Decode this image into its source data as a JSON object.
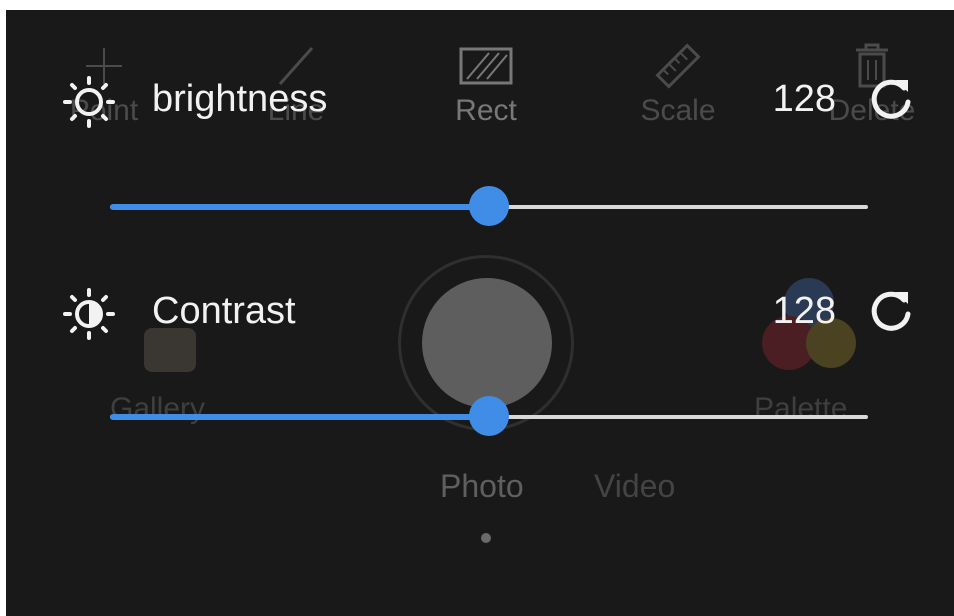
{
  "background_ui": {
    "tools": [
      {
        "id": "point",
        "label": "Point",
        "icon": "crosshair-icon"
      },
      {
        "id": "line",
        "label": "Line",
        "icon": "line-icon"
      },
      {
        "id": "rect",
        "label": "Rect",
        "icon": "rect-icon"
      },
      {
        "id": "scale",
        "label": "Scale",
        "icon": "ruler-icon"
      },
      {
        "id": "delete",
        "label": "Delete",
        "icon": "trash-icon"
      }
    ],
    "gallery_label": "Gallery",
    "palette_label": "Palette",
    "modes": {
      "photo": "Photo",
      "video": "Video"
    }
  },
  "controls": [
    {
      "id": "brightness",
      "label": "brightness",
      "value": "128",
      "level": 0.5,
      "icon": "sun-icon",
      "reset_icon": "reset-icon"
    },
    {
      "id": "contrast",
      "label": "Contrast",
      "value": "128",
      "level": 0.5,
      "icon": "contrast-icon",
      "reset_icon": "reset-icon"
    }
  ],
  "colors": {
    "accent": "#3f8de6",
    "background": "#191919",
    "text": "#f2f2f2"
  }
}
